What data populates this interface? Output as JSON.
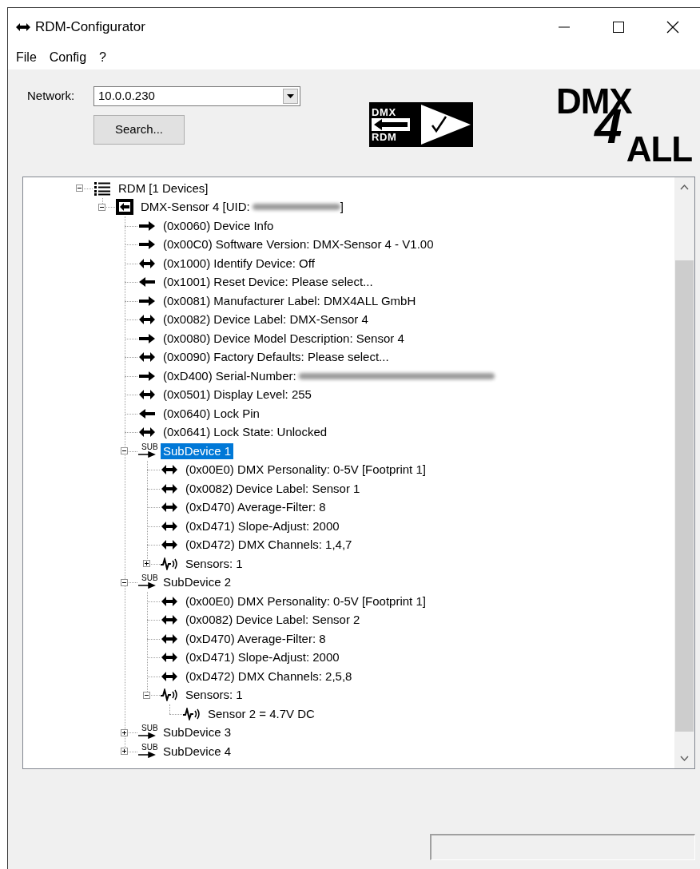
{
  "window": {
    "title": "RDM-Configurator"
  },
  "menu": [
    {
      "label": "File"
    },
    {
      "label": "Config"
    },
    {
      "label": "?"
    }
  ],
  "network": {
    "label": "Network:",
    "value": "10.0.0.230"
  },
  "search_button": "Search...",
  "logo_badge": {
    "top": "DMX",
    "bottom": "RDM"
  },
  "logo_brand": {
    "top": "DMX",
    "middle": "4",
    "bottom": "ALL"
  },
  "tree": [
    {
      "kind": "list",
      "label": "RDM [1 Devices]",
      "expanded": true,
      "selected": false,
      "children": [
        {
          "kind": "device",
          "label": "DMX-Sensor 4 [UID:",
          "redacted": true,
          "label_end": "]",
          "expanded": true,
          "selected": false,
          "children": [
            {
              "kind": "out",
              "label": "(0x0060) Device Info",
              "selected": false
            },
            {
              "kind": "out",
              "label": "(0x00C0) Software Version: DMX-Sensor 4 - V1.00",
              "selected": false
            },
            {
              "kind": "both",
              "label": "(0x1000) Identify Device: Off",
              "selected": false
            },
            {
              "kind": "in",
              "label": "(0x1001) Reset Device: Please select...",
              "selected": false
            },
            {
              "kind": "out",
              "label": "(0x0081) Manufacturer Label: DMX4ALL GmbH",
              "selected": false
            },
            {
              "kind": "both",
              "label": "(0x0082) Device Label: DMX-Sensor 4",
              "selected": false
            },
            {
              "kind": "out",
              "label": "(0x0080) Device Model Description: Sensor 4",
              "selected": false
            },
            {
              "kind": "both",
              "label": "(0x0090) Factory Defaults: Please select...",
              "selected": false
            },
            {
              "kind": "out",
              "label": "(0xD400) Serial-Number:",
              "redacted": true,
              "selected": false
            },
            {
              "kind": "both",
              "label": "(0x0501) Display Level: 255",
              "selected": false
            },
            {
              "kind": "in",
              "label": "(0x0640) Lock Pin",
              "selected": false
            },
            {
              "kind": "both",
              "label": "(0x0641) Lock State: Unlocked",
              "selected": false
            },
            {
              "kind": "sub",
              "badge": "SUB",
              "label": "SubDevice 1",
              "expanded": true,
              "selected": true,
              "children": [
                {
                  "kind": "both",
                  "label": "(0x00E0) DMX Personality: 0-5V [Footprint 1]",
                  "selected": false
                },
                {
                  "kind": "both",
                  "label": "(0x0082) Device Label: Sensor 1",
                  "selected": false
                },
                {
                  "kind": "both",
                  "label": "(0xD470) Average-Filter: 8",
                  "selected": false
                },
                {
                  "kind": "both",
                  "label": "(0xD471) Slope-Adjust: 2000",
                  "selected": false
                },
                {
                  "kind": "both",
                  "label": "(0xD472) DMX Channels: 1,4,7",
                  "selected": false
                },
                {
                  "kind": "sensor",
                  "label": "Sensors: 1",
                  "expanded": false,
                  "selected": false
                }
              ]
            },
            {
              "kind": "sub",
              "badge": "SUB",
              "label": "SubDevice 2",
              "expanded": true,
              "selected": false,
              "children": [
                {
                  "kind": "both",
                  "label": "(0x00E0) DMX Personality: 0-5V [Footprint 1]",
                  "selected": false
                },
                {
                  "kind": "both",
                  "label": "(0x0082) Device Label: Sensor 2",
                  "selected": false
                },
                {
                  "kind": "both",
                  "label": "(0xD470) Average-Filter: 8",
                  "selected": false
                },
                {
                  "kind": "both",
                  "label": "(0xD471) Slope-Adjust: 2000",
                  "selected": false
                },
                {
                  "kind": "both",
                  "label": "(0xD472) DMX Channels: 2,5,8",
                  "selected": false
                },
                {
                  "kind": "sensor",
                  "label": "Sensors: 1",
                  "expanded": true,
                  "selected": false,
                  "children": [
                    {
                      "kind": "sensor",
                      "label": "Sensor 2 = 4.7V DC",
                      "selected": false
                    }
                  ]
                }
              ]
            },
            {
              "kind": "sub",
              "badge": "SUB",
              "label": "SubDevice 3",
              "expanded": false,
              "selected": false
            },
            {
              "kind": "sub",
              "badge": "SUB",
              "label": "SubDevice 4",
              "expanded": false,
              "selected": false
            }
          ]
        }
      ]
    }
  ]
}
